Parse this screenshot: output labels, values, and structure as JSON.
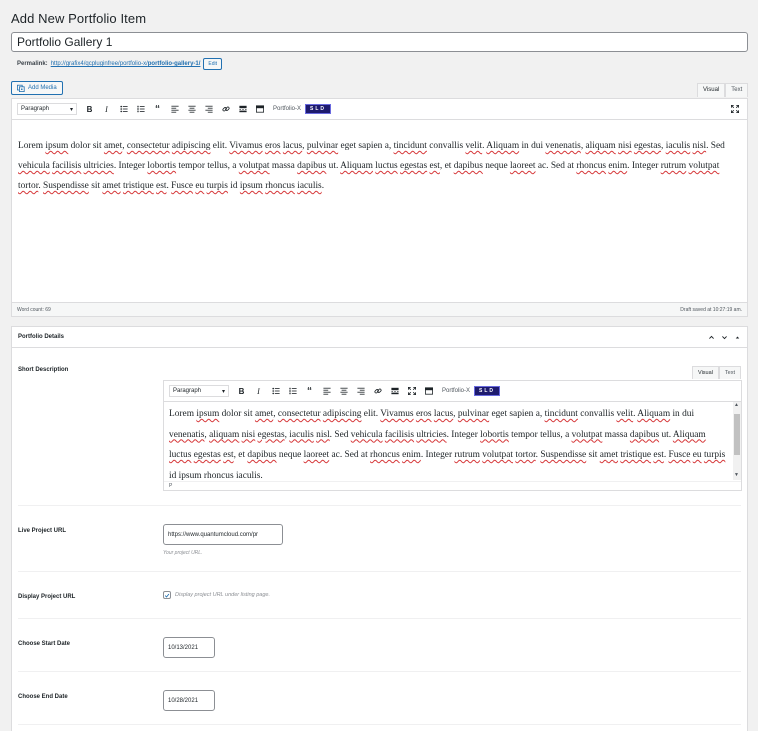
{
  "page": {
    "title": "Add New Portfolio Item"
  },
  "post": {
    "title": "Portfolio Gallery 1",
    "permalink_label": "Permalink:",
    "permalink_base": "http://grafix4/qcpluginfree/portfolio-x/",
    "permalink_slug": "portfolio-gallery-1/",
    "edit_label": "Edit"
  },
  "media": {
    "add_label": "Add Media"
  },
  "editor": {
    "tabs": [
      "Visual",
      "Text"
    ],
    "active_tab": "Visual",
    "format": "Paragraph",
    "toolbar_icons": [
      "bold-icon",
      "italic-icon",
      "bullet-list-icon",
      "numbered-list-icon",
      "blockquote-icon",
      "align-left-icon",
      "align-center-icon",
      "align-right-icon",
      "link-icon",
      "read-more-icon",
      "toolbar-toggle-icon"
    ],
    "plugin_label": "Portfolio-X",
    "plugin_badge": "SLD",
    "content": "Lorem ipsum dolor sit amet, consectetur adipiscing elit. Vivamus eros lacus, pulvinar eget sapien a, tincidunt convallis velit. Aliquam in dui venenatis, aliquam nisi egestas, iaculis nisl. Sed vehicula facilisis ultricies. Integer lobortis tempor tellus, a volutpat massa dapibus ut. Aliquam luctus egestas est, et dapibus neque laoreet ac. Sed at rhoncus enim. Integer rutrum volutpat tortor. Suspendisse sit amet tristique est. Fusce eu turpis id ipsum rhoncus iaculis.",
    "word_count": "Word count: 69",
    "draft_status": "Draft saved at 10:27:19 am."
  },
  "details": {
    "title": "Portfolio Details",
    "short_description": {
      "label": "Short Description",
      "tabs": [
        "Visual",
        "Text"
      ],
      "format": "Paragraph",
      "plugin_label": "Portfolio-X",
      "plugin_badge": "SLD",
      "content": "Lorem ipsum dolor sit amet, consectetur adipiscing elit. Vivamus eros lacus, pulvinar eget sapien a, tincidunt convallis velit. Aliquam in dui venenatis, aliquam nisi egestas, iaculis nisl. Sed vehicula facilisis ultricies. Integer lobortis tempor tellus, a volutpat massa dapibus ut. Aliquam luctus egestas est, et dapibus neque laoreet ac. Sed at rhoncus enim. Integer rutrum volutpat tortor. Suspendisse sit amet tristique est. Fusce eu turpis id ipsum rhoncus iaculis.",
      "path": "P"
    },
    "live_url": {
      "label": "Live Project URL",
      "value": "https://www.quantumcloud.com/pr",
      "hint": "Your project URL."
    },
    "display_url": {
      "label": "Display Project URL",
      "checked": true,
      "hint": "Display project URL under listing page."
    },
    "start_date": {
      "label": "Choose Start Date",
      "value": "10/13/2021"
    },
    "end_date": {
      "label": "Choose End Date",
      "value": "10/28/2021"
    }
  }
}
